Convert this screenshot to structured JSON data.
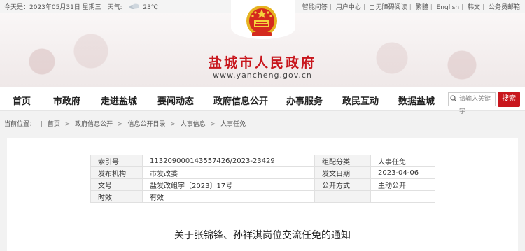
{
  "topbar": {
    "date": "今天是：2023年05月31日 星期三",
    "weather_label": "天气:",
    "weather_icon": "cloudy-icon",
    "temperature": "23℃",
    "links": [
      "智能问答",
      "用户中心",
      "无障碍阅读",
      "繁體",
      "English",
      "韩文",
      "公务员邮箱"
    ]
  },
  "header": {
    "emblem": "national-emblem",
    "title": "盐城市人民政府",
    "url": "www.yancheng.gov.cn"
  },
  "nav": {
    "items": [
      "首页",
      "市政府",
      "走进盐城",
      "要闻动态",
      "政府信息公开",
      "办事服务",
      "政民互动",
      "数据盐城"
    ],
    "search_placeholder": "请输入关键字",
    "search_button": "搜索"
  },
  "breadcrumb": {
    "label": "当前位置：",
    "items": [
      "首页",
      "政府信息公开",
      "信息公开目录",
      "人事信息",
      "人事任免"
    ]
  },
  "meta": {
    "rows": [
      [
        "索引号",
        "113209000143557426/2023-23429",
        "组配分类",
        "人事任免"
      ],
      [
        "发布机构",
        "市发改委",
        "发文日期",
        "2023-04-06"
      ],
      [
        "文号",
        "盐发改组字〔2023〕17号",
        "公开方式",
        "主动公开"
      ],
      [
        "时效",
        "有效",
        "",
        ""
      ]
    ]
  },
  "document": {
    "title": "关于张锦锋、孙祥淇岗位交流任免的通知"
  },
  "colors": {
    "brand_red": "#c8161d"
  }
}
